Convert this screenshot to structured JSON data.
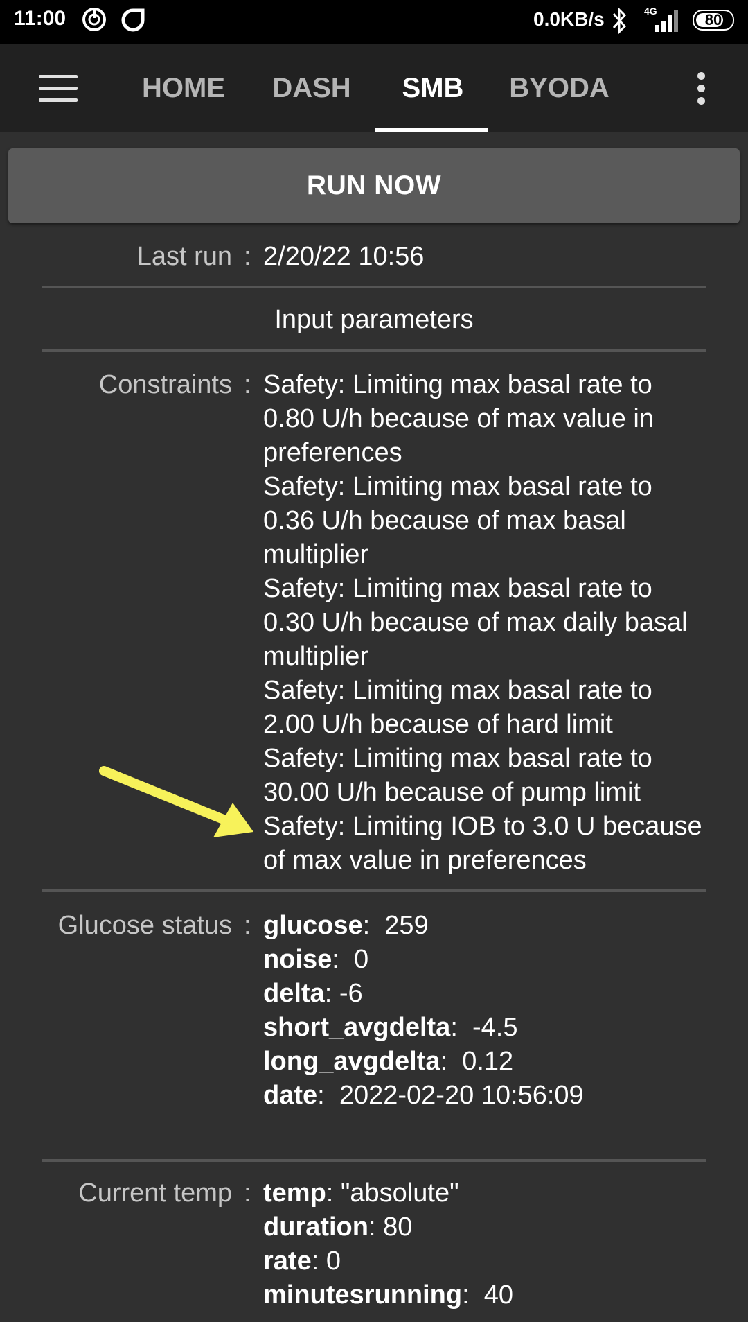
{
  "status_bar": {
    "time": "11:00",
    "net_speed": "0.0KB/s",
    "network_type": "4G",
    "battery": "80"
  },
  "tabs": [
    {
      "label": "HOME"
    },
    {
      "label": "DASH"
    },
    {
      "label": "SMB"
    },
    {
      "label": "BYODA"
    }
  ],
  "run_now_label": "RUN NOW",
  "last_run": {
    "label": "Last run",
    "value": "2/20/22 10:56"
  },
  "input_parameters_title": "Input parameters",
  "constraints": {
    "label": "Constraints",
    "lines": [
      "Safety: Limiting max basal rate to",
      "0.80 U/h because of max value in",
      "preferences",
      "Safety: Limiting max basal rate to",
      "0.36 U/h because of max basal",
      "multiplier",
      "Safety: Limiting max basal rate to",
      "0.30 U/h because of max daily basal",
      "multiplier",
      "Safety: Limiting max basal rate to",
      "2.00 U/h because of hard limit",
      "Safety: Limiting max basal rate to",
      "30.00 U/h because of pump limit",
      "Safety: Limiting IOB to 3.0 U because",
      "of max value in preferences"
    ]
  },
  "glucose_status": {
    "label": "Glucose status",
    "items": [
      {
        "key": "glucose",
        "value": "259"
      },
      {
        "key": "noise",
        "value": "0"
      },
      {
        "key": "delta",
        "value": "-6"
      },
      {
        "key": "short_avgdelta",
        "value": "-4.5"
      },
      {
        "key": "long_avgdelta",
        "value": "0.12"
      },
      {
        "key": "date",
        "value": "2022-02-20 10:56:09"
      }
    ]
  },
  "current_temp": {
    "label": "Current temp",
    "items": [
      {
        "key": "temp",
        "value": "\"absolute\""
      },
      {
        "key": "duration",
        "value": "80"
      },
      {
        "key": "rate",
        "value": "0"
      },
      {
        "key": "minutesrunning",
        "value": "40"
      }
    ]
  },
  "colors": {
    "background": "#303030",
    "toolbar": "#212121",
    "button": "#5a5a5a",
    "annotation_arrow": "#f7f25a"
  }
}
